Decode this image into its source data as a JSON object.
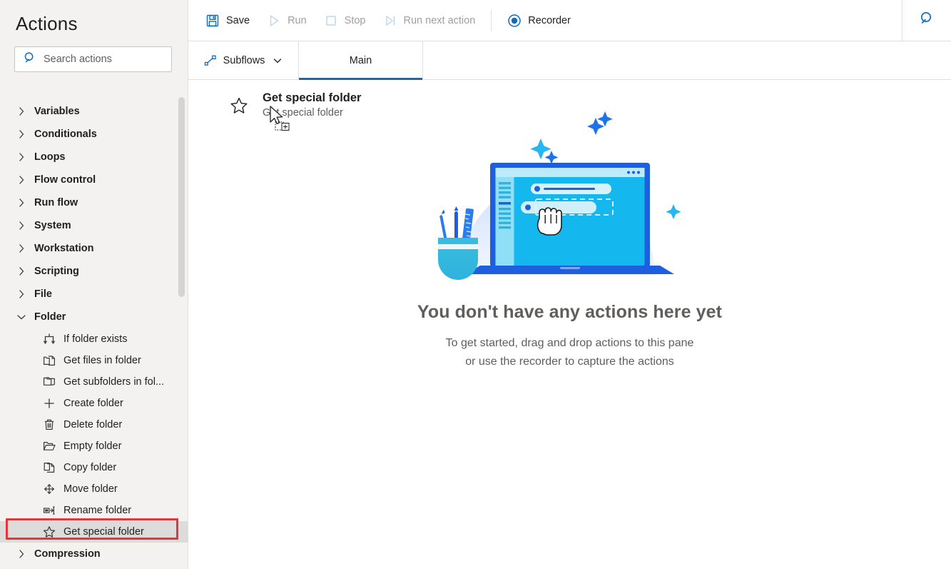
{
  "sidebar": {
    "title": "Actions",
    "search": {
      "placeholder": "Search actions",
      "value": "",
      "icon": "search-icon"
    },
    "categories": [
      {
        "label": "Variables",
        "icon": "chevron-right-icon",
        "expanded": false
      },
      {
        "label": "Conditionals",
        "icon": "chevron-right-icon",
        "expanded": false
      },
      {
        "label": "Loops",
        "icon": "chevron-right-icon",
        "expanded": false
      },
      {
        "label": "Flow control",
        "icon": "chevron-right-icon",
        "expanded": false
      },
      {
        "label": "Run flow",
        "icon": "chevron-right-icon",
        "expanded": false
      },
      {
        "label": "System",
        "icon": "chevron-right-icon",
        "expanded": false
      },
      {
        "label": "Workstation",
        "icon": "chevron-right-icon",
        "expanded": false
      },
      {
        "label": "Scripting",
        "icon": "chevron-right-icon",
        "expanded": false
      },
      {
        "label": "File",
        "icon": "chevron-right-icon",
        "expanded": false
      },
      {
        "label": "Folder",
        "icon": "chevron-down-icon",
        "expanded": true
      },
      {
        "label": "Compression",
        "icon": "chevron-right-icon",
        "expanded": false
      }
    ],
    "folder_actions": [
      {
        "label": "If folder exists",
        "icon": "branch-icon",
        "selected": false
      },
      {
        "label": "Get files in folder",
        "icon": "folder-file-icon",
        "selected": false
      },
      {
        "label": "Get subfolders in fol...",
        "icon": "folder-stack-icon",
        "selected": false
      },
      {
        "label": "Create folder",
        "icon": "plus-icon",
        "selected": false
      },
      {
        "label": "Delete folder",
        "icon": "trash-icon",
        "selected": false
      },
      {
        "label": "Empty folder",
        "icon": "folder-open-icon",
        "selected": false
      },
      {
        "label": "Copy folder",
        "icon": "copy-icon",
        "selected": false
      },
      {
        "label": "Move folder",
        "icon": "move-arrows-icon",
        "selected": false
      },
      {
        "label": "Rename folder",
        "icon": "rename-icon",
        "selected": false
      },
      {
        "label": "Get special folder",
        "icon": "star-icon",
        "selected": true
      }
    ],
    "highlight_color": "#e8333a",
    "selected_bg": "#dedcdb"
  },
  "toolbar": {
    "buttons": [
      {
        "label": "Save",
        "icon": "save-icon",
        "enabled": true
      },
      {
        "label": "Run",
        "icon": "play-icon",
        "enabled": false
      },
      {
        "label": "Stop",
        "icon": "stop-square-icon",
        "enabled": false
      },
      {
        "label": "Run next action",
        "icon": "step-over-icon",
        "enabled": false
      },
      {
        "label": "Recorder",
        "icon": "record-circle-icon",
        "enabled": true
      }
    ],
    "search_icon": "search-icon",
    "accent": "#0f6cbd"
  },
  "tabbar": {
    "subflows": {
      "label": "Subflows",
      "icon": "subflow-icon",
      "chevron": "chevron-down-icon"
    },
    "tabs": [
      {
        "label": "Main",
        "active": true
      }
    ]
  },
  "canvas": {
    "drag_item": {
      "icon": "star-icon",
      "title": "Get special folder",
      "subtitle": "Get special folder",
      "cursor": "drag-copy-cursor"
    },
    "empty_state": {
      "illustration": "laptop-drag-drop-illustration",
      "title": "You don't have any actions here yet",
      "line1": "To get started, drag and drop actions to this pane",
      "line2": "or use the recorder to capture the actions"
    }
  }
}
